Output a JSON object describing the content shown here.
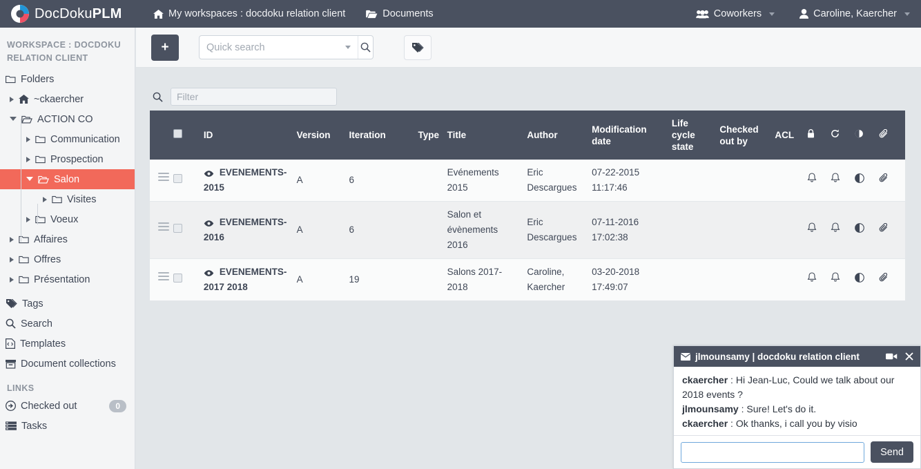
{
  "brand": {
    "name_light": "DocDoku",
    "name_bold": "PLM"
  },
  "topnav": {
    "workspaces_label": "My workspaces : docdoku relation client",
    "documents_label": "Documents",
    "coworkers_label": "Coworkers",
    "user_label": "Caroline, Kaercher"
  },
  "sidebar": {
    "workspace_title": "WORKSPACE : DOCDOKU RELATION CLIENT",
    "folders_label": "Folders",
    "tree": [
      {
        "label": "~ckaercher",
        "icon": "home-icon",
        "indent": 1,
        "open": false,
        "selected": false
      },
      {
        "label": "ACTION CO",
        "icon": "folder-open-icon",
        "indent": 1,
        "open": true,
        "selected": false
      },
      {
        "label": "Communication",
        "icon": "folder-icon",
        "indent": 2,
        "open": false,
        "selected": false
      },
      {
        "label": "Prospection",
        "icon": "folder-icon",
        "indent": 2,
        "open": false,
        "selected": false
      },
      {
        "label": "Salon",
        "icon": "folder-open-icon",
        "indent": 2,
        "open": true,
        "selected": true
      },
      {
        "label": "Visites",
        "icon": "folder-icon",
        "indent": 3,
        "open": false,
        "selected": false
      },
      {
        "label": "Voeux",
        "icon": "folder-icon",
        "indent": 2,
        "open": false,
        "selected": false
      },
      {
        "label": "Affaires",
        "icon": "folder-icon",
        "indent": 1,
        "open": false,
        "selected": false
      },
      {
        "label": "Offres",
        "icon": "folder-icon",
        "indent": 1,
        "open": false,
        "selected": false
      },
      {
        "label": "Présentation",
        "icon": "folder-icon",
        "indent": 1,
        "open": false,
        "selected": false
      }
    ],
    "nav": [
      {
        "label": "Tags",
        "icon": "tags-icon"
      },
      {
        "label": "Search",
        "icon": "search-icon"
      },
      {
        "label": "Templates",
        "icon": "template-icon"
      },
      {
        "label": "Document collections",
        "icon": "collections-icon"
      }
    ],
    "links_title": "LINKS",
    "links": [
      {
        "label": "Checked out",
        "icon": "arrow-circle-icon",
        "badge": "0"
      },
      {
        "label": "Tasks",
        "icon": "tasks-icon",
        "badge": null
      }
    ]
  },
  "toolbar": {
    "add_label": "+",
    "quick_search_placeholder": "Quick search",
    "quick_search_value": "",
    "search_icon": "search-icon",
    "tag_icon": "tags-icon"
  },
  "filter": {
    "icon": "search-icon",
    "placeholder": "Filter",
    "value": ""
  },
  "table": {
    "columns": [
      "",
      "",
      "ID",
      "Version",
      "Iteration",
      "Type",
      "Title",
      "Author",
      "Modification date",
      "Life cycle state",
      "Checked out by",
      "ACL"
    ],
    "icon_columns": [
      "lock-icon",
      "refresh-icon",
      "globe-icon",
      "paperclip-icon"
    ],
    "rows": [
      {
        "id": "EVENEMENTS-2015",
        "version": "A",
        "iteration": "6",
        "type": "",
        "title": "Evénements 2015",
        "author": "Eric Descargues",
        "modification_date": "07-22-2015 11:17:46",
        "life_cycle_state": "",
        "checked_out_by": "",
        "acl": "",
        "icons": [
          "bell-icon",
          "bell-icon",
          "globe-icon",
          "paperclip-icon"
        ]
      },
      {
        "id": "EVENEMENTS-2016",
        "version": "A",
        "iteration": "6",
        "type": "",
        "title": "Salon et évènements 2016",
        "author": "Eric Descargues",
        "modification_date": "07-11-2016 17:02:38",
        "life_cycle_state": "",
        "checked_out_by": "",
        "acl": "",
        "icons": [
          "bell-icon",
          "bell-icon",
          "globe-icon",
          "paperclip-icon"
        ]
      },
      {
        "id": "EVENEMENTS-2017 2018",
        "version": "A",
        "iteration": "19",
        "type": "",
        "title": "Salons 2017-2018",
        "author": "Caroline, Kaercher",
        "modification_date": "03-20-2018 17:49:07",
        "life_cycle_state": "",
        "checked_out_by": "",
        "acl": "",
        "icons": [
          "bell-icon",
          "bell-icon",
          "globe-icon",
          "paperclip-icon"
        ]
      }
    ]
  },
  "chat": {
    "title": "jlmounsamy | docdoku relation client",
    "mail_icon": "envelope-icon",
    "video_icon": "video-camera-icon",
    "close_icon": "close-icon",
    "messages": [
      {
        "who": "ckaercher",
        "text": " : Hi Jean-Luc, Could we talk about our 2018 events ?"
      },
      {
        "who": "jlmounsamy",
        "text": " : Sure! Let's do it."
      },
      {
        "who": "ckaercher",
        "text": " : Ok thanks, i call you by visio"
      }
    ],
    "input_value": "",
    "send_label": "Send"
  },
  "colors": {
    "nav_bg": "#4a5160",
    "accent_selected": "#f2695a",
    "content_bg": "#e2e6e9",
    "sidebar_bg": "#f4f5f6"
  }
}
